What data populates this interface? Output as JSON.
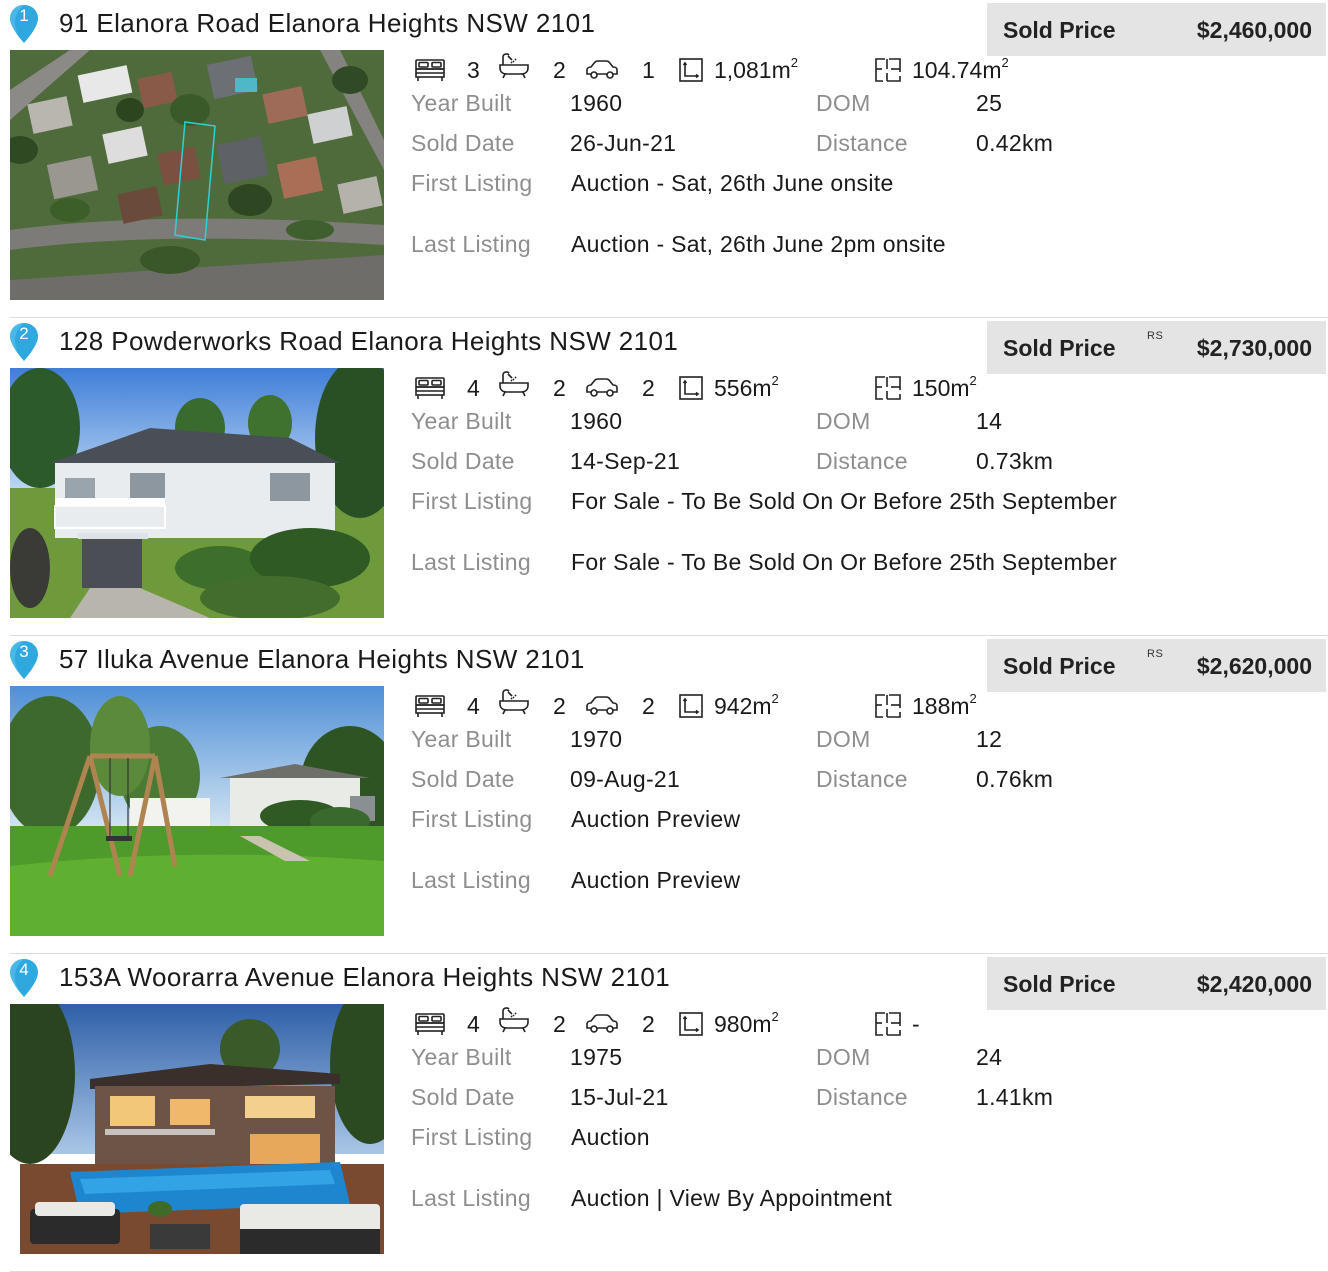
{
  "labels": {
    "sold_price": "Sold Price",
    "year_built": "Year Built",
    "dom": "DOM",
    "sold_date": "Sold Date",
    "distance": "Distance",
    "first_listing": "First Listing",
    "last_listing": "Last Listing",
    "area_unit": "m",
    "area_exp": "2"
  },
  "colors": {
    "pin": "#2fa8e0",
    "price_box": "#e4e4e4",
    "label": "#8e8e8e"
  },
  "icons": [
    "map-pin-icon",
    "bed-icon",
    "bath-icon",
    "car-icon",
    "land-size-icon",
    "floor-plan-icon"
  ],
  "listings": [
    {
      "number": "1",
      "address": "91 Elanora Road Elanora Heights NSW 2101",
      "sold_price": "$2,460,000",
      "rs": "",
      "beds": "3",
      "baths": "2",
      "cars": "1",
      "land": "1,081",
      "floor": "104.74",
      "year_built": "1960",
      "dom": "25",
      "sold_date": "26-Jun-21",
      "distance": "0.42km",
      "first_listing": "Auction - Sat, 26th June onsite",
      "last_listing": "Auction - Sat, 26th June 2pm onsite"
    },
    {
      "number": "2",
      "address": "128 Powderworks Road Elanora Heights NSW 2101",
      "sold_price": "$2,730,000",
      "rs": "RS",
      "beds": "4",
      "baths": "2",
      "cars": "2",
      "land": "556",
      "floor": "150",
      "year_built": "1960",
      "dom": "14",
      "sold_date": "14-Sep-21",
      "distance": "0.73km",
      "first_listing": "For Sale - To Be Sold On Or Before 25th September",
      "last_listing": "For Sale - To Be Sold On Or Before 25th September"
    },
    {
      "number": "3",
      "address": "57 Iluka Avenue Elanora Heights NSW 2101",
      "sold_price": "$2,620,000",
      "rs": "RS",
      "beds": "4",
      "baths": "2",
      "cars": "2",
      "land": "942",
      "floor": "188",
      "year_built": "1970",
      "dom": "12",
      "sold_date": "09-Aug-21",
      "distance": "0.76km",
      "first_listing": "Auction Preview",
      "last_listing": "Auction Preview"
    },
    {
      "number": "4",
      "address": "153A Woorarra Avenue Elanora Heights NSW 2101",
      "sold_price": "$2,420,000",
      "rs": "",
      "beds": "4",
      "baths": "2",
      "cars": "2",
      "land": "980",
      "floor": "-",
      "year_built": "1975",
      "dom": "24",
      "sold_date": "15-Jul-21",
      "distance": "1.41km",
      "first_listing": "Auction",
      "last_listing": "Auction | View By Appointment"
    }
  ]
}
